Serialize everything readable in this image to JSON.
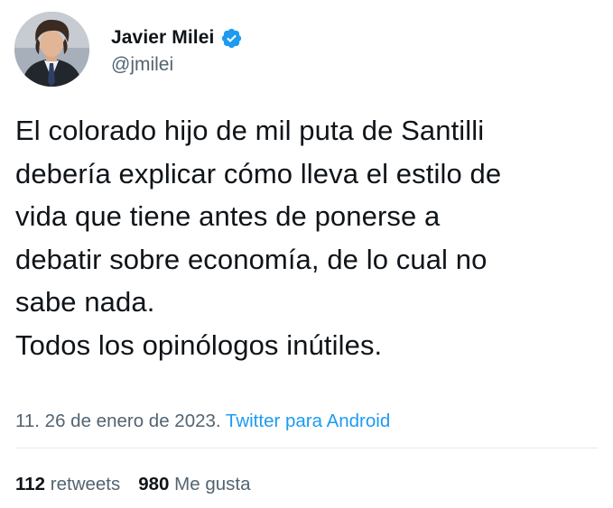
{
  "author": {
    "display_name": "Javier Milei",
    "handle": "@jmilei",
    "verified": true,
    "avatar": "profile-photo"
  },
  "tweet": {
    "text": "El colorado hijo de mil puta de Santilli\ndebería explicar cómo lleva el estilo de\nvida que tiene antes de ponerse a\ndebatir sobre economía, de lo cual no\nsabe nada.\nTodos los opinólogos inútiles.",
    "timestamp": "11. 26 de enero de 2023. ",
    "source": "Twitter para Android"
  },
  "stats": {
    "retweets_count": "112",
    "retweets_label": " retweets",
    "likes_count": "980",
    "likes_label": " Me gusta"
  },
  "colors": {
    "text": "#0f1419",
    "secondary": "#536471",
    "accent": "#1d9bf0",
    "divider": "#e6ecf0"
  },
  "icons": {
    "verified": "verified-badge-icon"
  }
}
